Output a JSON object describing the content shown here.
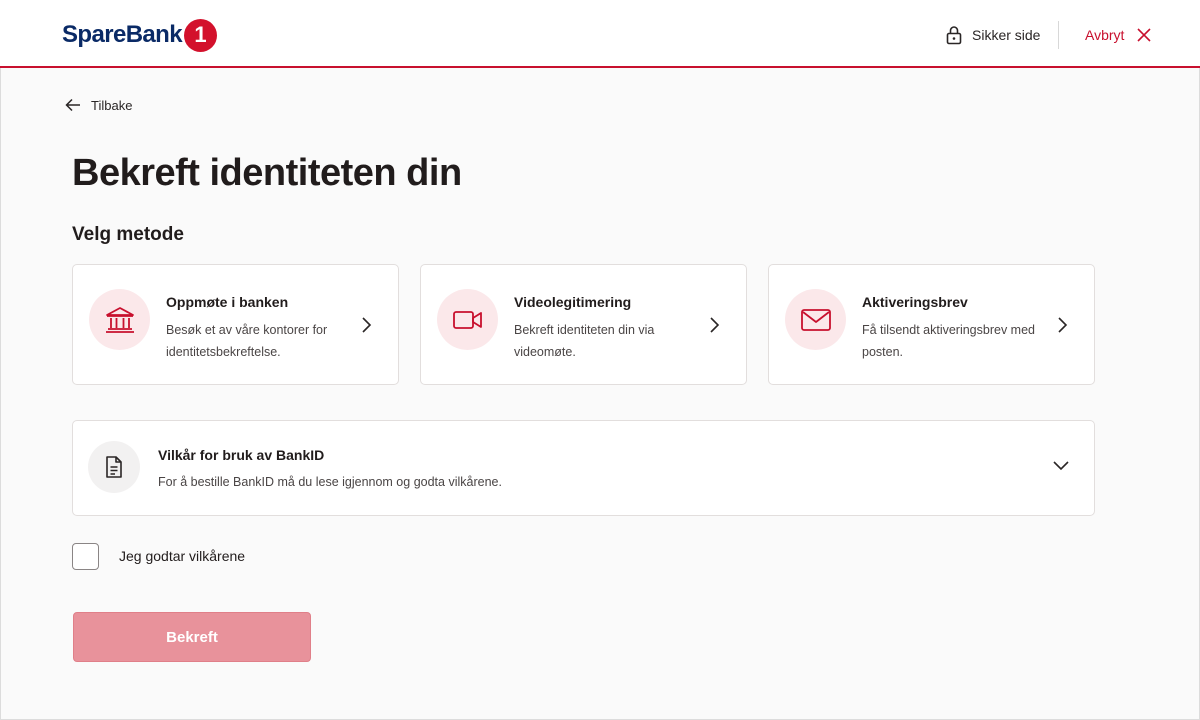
{
  "header": {
    "logo_text": "SpareBank",
    "logo_badge": "1",
    "secure_label": "Sikker side",
    "cancel_label": "Avbryt"
  },
  "nav": {
    "back_label": "Tilbake"
  },
  "page": {
    "title": "Bekreft identiteten din",
    "subtitle": "Velg metode"
  },
  "methods": [
    {
      "title": "Oppmøte i banken",
      "description": "Besøk et av våre kontorer for identitetsbekreftelse.",
      "icon": "bank-icon"
    },
    {
      "title": "Videolegitimering",
      "description": "Bekreft identiteten din via videomøte.",
      "icon": "video-camera-icon"
    },
    {
      "title": "Aktiveringsbrev",
      "description": "Få tilsendt aktiveringsbrev med posten.",
      "icon": "envelope-icon"
    }
  ],
  "terms": {
    "title": "Vilkår for bruk av BankID",
    "description": "For å bestille BankID må du lese igjennom og godta vilkårene.",
    "icon": "document-icon"
  },
  "consent": {
    "label": "Jeg godtar vilkårene",
    "checked": false
  },
  "confirm": {
    "label": "Bekreft",
    "enabled": false
  },
  "colors": {
    "brand_red": "#c8102e",
    "brand_navy": "#0a2a66",
    "icon_bg_pink": "#fbe8ea",
    "disabled_button": "#e8929b"
  }
}
